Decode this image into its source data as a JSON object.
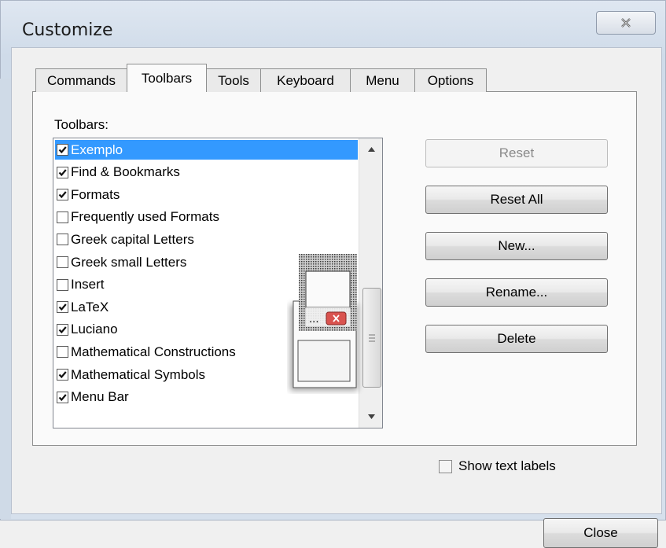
{
  "window": {
    "title": "Customize"
  },
  "tabs": [
    {
      "label": "Commands",
      "active": false
    },
    {
      "label": "Toolbars",
      "active": true
    },
    {
      "label": "Tools",
      "active": false
    },
    {
      "label": "Keyboard",
      "active": false
    },
    {
      "label": "Menu",
      "active": false
    },
    {
      "label": "Options",
      "active": false
    }
  ],
  "toolbars_label": "Toolbars:",
  "toolbars_list": [
    {
      "label": "Exemplo",
      "checked": true,
      "selected": true
    },
    {
      "label": "Find & Bookmarks",
      "checked": true,
      "selected": false
    },
    {
      "label": "Formats",
      "checked": true,
      "selected": false
    },
    {
      "label": "Frequently used Formats",
      "checked": false,
      "selected": false
    },
    {
      "label": "Greek capital Letters",
      "checked": false,
      "selected": false
    },
    {
      "label": "Greek small Letters",
      "checked": false,
      "selected": false
    },
    {
      "label": "Insert",
      "checked": false,
      "selected": false
    },
    {
      "label": "LaTeX",
      "checked": true,
      "selected": false
    },
    {
      "label": "Luciano",
      "checked": true,
      "selected": false
    },
    {
      "label": "Mathematical Constructions",
      "checked": false,
      "selected": false
    },
    {
      "label": "Mathematical Symbols",
      "checked": true,
      "selected": false
    },
    {
      "label": "Menu Bar",
      "checked": true,
      "selected": false
    }
  ],
  "buttons": {
    "reset": "Reset",
    "reset_all": "Reset All",
    "new": "New...",
    "rename": "Rename...",
    "delete": "Delete",
    "close": "Close"
  },
  "show_text_labels": {
    "label": "Show text labels",
    "checked": false
  },
  "drag_ghost": {
    "dots": "..."
  },
  "colors": {
    "selection": "#3399ff",
    "ghost_close": "#d9534f"
  }
}
